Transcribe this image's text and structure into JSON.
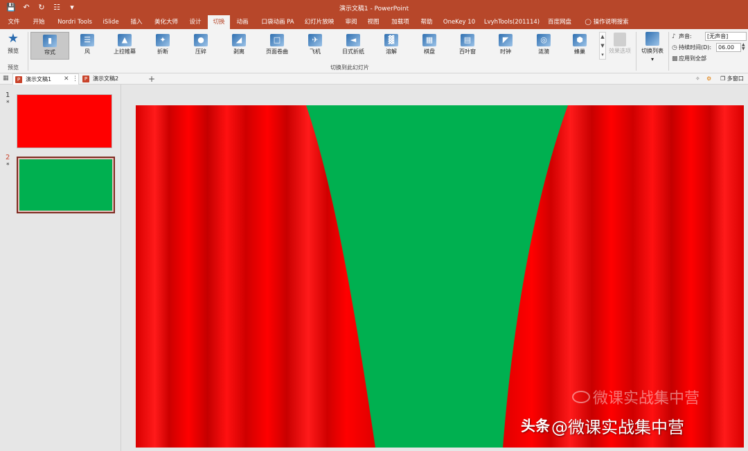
{
  "window": {
    "title": "演示文稿1  -  PowerPoint"
  },
  "ribbon_tabs": [
    "文件",
    "开始",
    "Nordri Tools",
    "iSlide",
    "插入",
    "美化大师",
    "设计",
    "切换",
    "动画",
    "口袋动画 PA",
    "幻灯片放映",
    "审阅",
    "视图",
    "加载项",
    "帮助",
    "OneKey 10",
    "LvyhTools(201114)",
    "百度网盘",
    "操作说明搜索"
  ],
  "active_tab": "切换",
  "ribbon": {
    "preview_label": "预览",
    "preview_group": "预览",
    "transitions_group": "切换到此幻灯片",
    "transitions": [
      "帘式",
      "风",
      "上拉帷幕",
      "折断",
      "压碎",
      "剥离",
      "页面卷曲",
      "飞机",
      "日式折纸",
      "溶解",
      "棋盘",
      "百叶窗",
      "时钟",
      "涟漪",
      "蜂巢"
    ],
    "selected_transition": "帘式",
    "effect_options": "效果选项",
    "transition_list": "切换列表",
    "sound_label": "声音:",
    "sound_value": "[无声音]",
    "duration_label": "持续时间(D):",
    "duration_value": "06.00",
    "apply_all": "应用到全部"
  },
  "doc_tabs": [
    "演示文稿1",
    "演示文稿2"
  ],
  "active_doc": "演示文稿1",
  "multi_window": "多窗口",
  "slides": [
    {
      "number": "1",
      "mark": "*",
      "color": "#ff0000"
    },
    {
      "number": "2",
      "mark": "*",
      "color": "#00b050"
    }
  ],
  "canvas": {
    "background": "#00b050",
    "curtain_color": "#ff0000"
  },
  "watermark": {
    "brand": "头条",
    "text": "@微课实战集中营",
    "ghost": "微课实战集中营"
  },
  "icons": {
    "save": "save-icon",
    "undo": "undo-icon",
    "redo": "redo-icon",
    "customize": "customize-icon"
  }
}
